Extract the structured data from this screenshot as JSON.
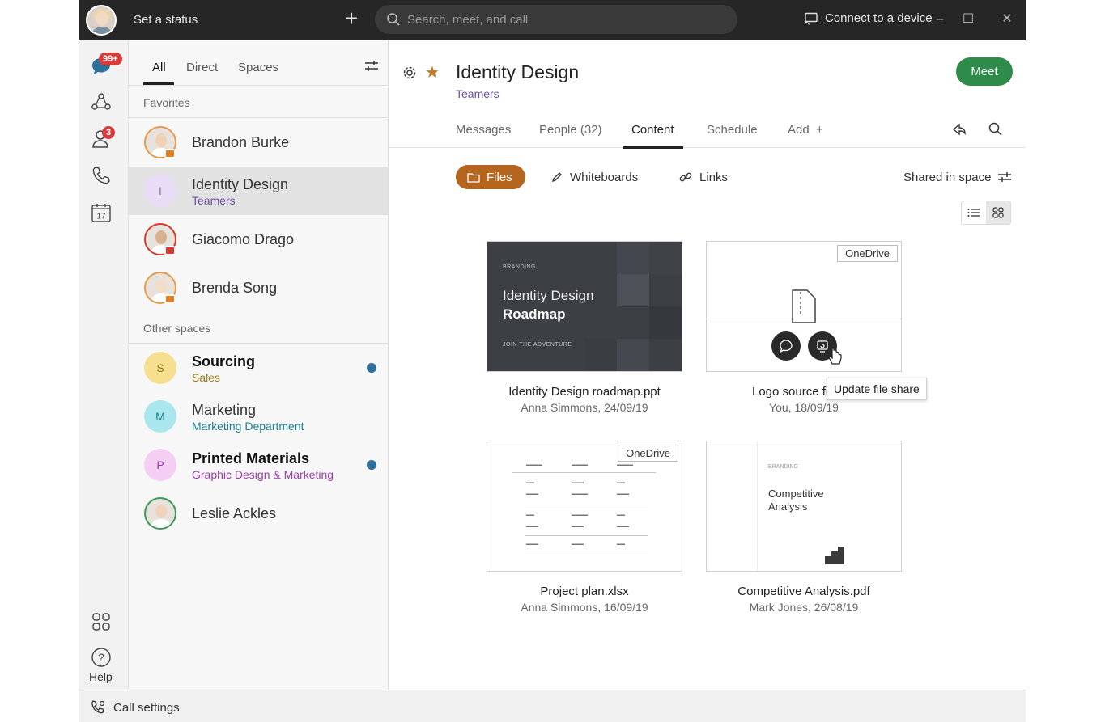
{
  "topbar": {
    "status_label": "Set a status",
    "search_placeholder": "Search, meet, and call",
    "connect_label": "Connect to a device",
    "window_buttons": [
      "minimize-icon",
      "maximize-icon",
      "close-icon"
    ]
  },
  "rail": {
    "messaging_badge": "99+",
    "contacts_badge": "3",
    "calendar_day": "17",
    "help_label": "Help"
  },
  "list": {
    "filters": [
      "All",
      "Direct",
      "Spaces"
    ],
    "active_filter": "All",
    "favorites_label": "Favorites",
    "other_label": "Other spaces",
    "favorites": [
      {
        "name": "Brandon Burke",
        "presence": "orange"
      },
      {
        "initial": "I",
        "name": "Identity Design",
        "sub": "Teamers",
        "sub_color": "#6b4fa5",
        "av_color": "#e9dcf7",
        "selected": true
      },
      {
        "name": "Giacomo Drago",
        "presence": "red"
      },
      {
        "name": "Brenda Song",
        "presence": "orange"
      }
    ],
    "others": [
      {
        "initial": "S",
        "name": "Sourcing",
        "sub": "Sales",
        "sub_color": "#9a7a12",
        "av_color": "#f6e08f",
        "bold": true,
        "unread": true
      },
      {
        "initial": "M",
        "name": "Marketing",
        "sub": "Marketing Department",
        "sub_color": "#1a7f8e",
        "av_color": "#a9e6ee",
        "bold": false,
        "unread": false
      },
      {
        "initial": "P",
        "name": "Printed Materials",
        "sub": "Graphic Design & Marketing",
        "sub_color": "#9a3fa5",
        "av_color": "#f4cff3",
        "bold": true,
        "unread": true
      },
      {
        "name": "Leslie Ackles"
      }
    ]
  },
  "space": {
    "title": "Identity Design",
    "team": "Teamers",
    "meet_label": "Meet",
    "tabs": [
      "Messages",
      "People (32)",
      "Content",
      "Schedule",
      "Add"
    ],
    "active_tab": "Content",
    "content_filters": [
      "Files",
      "Whiteboards",
      "Links"
    ],
    "shared_label": "Shared in space"
  },
  "files": [
    {
      "title": "Identity Design roadmap.ppt",
      "meta": "Anna Simmons, 24/09/19",
      "thumb_top": "BRANDING",
      "thumb_t1": "Identity Design",
      "thumb_t2": "Roadmap",
      "thumb_bottom": "JOIN THE ADVENTURE"
    },
    {
      "title": "Logo source fi",
      "meta": "You, 18/09/19",
      "badge": "OneDrive"
    },
    {
      "title": "Project plan.xlsx",
      "meta": "Anna Simmons, 16/09/19",
      "badge": "OneDrive"
    },
    {
      "title": "Competitive Analysis.pdf",
      "meta": "Mark Jones, 26/08/19",
      "thumb_top": "BRANDING",
      "thumb_t1": "Competitive",
      "thumb_t2": "Analysis"
    }
  ],
  "tooltip": "Update file share",
  "bottom": {
    "call_settings": "Call settings"
  },
  "colors": {
    "accent": "#b5651d",
    "meet_green": "#2e8b4a",
    "badge_red": "#d93b3b",
    "topbar": "#262626"
  }
}
